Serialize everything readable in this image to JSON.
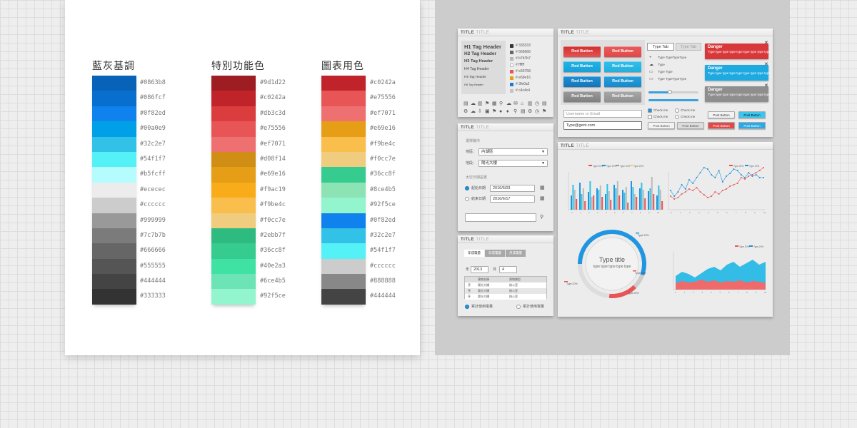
{
  "palette": {
    "gray_blue": {
      "title": "藍灰基調",
      "colors": [
        "#0863b8",
        "#086fcf",
        "#0f82ed",
        "#00a0e9",
        "#32c2e7",
        "#54f1f7",
        "#b5fcff",
        "#ececec",
        "#cccccc",
        "#999999",
        "#7c7b7b",
        "#666666",
        "#555555",
        "#444444",
        "#333333"
      ]
    },
    "function": {
      "title": "特別功能色",
      "colors": [
        "#9d1d22",
        "#c0242a",
        "#db3c3d",
        "#e75556",
        "#ef7071",
        "#d08f14",
        "#e69e16",
        "#f9ac19",
        "#f9be4c",
        "#f0cc7e",
        "#2ebb7f",
        "#36cc8f",
        "#40e2a3",
        "#6ce4b5",
        "#92f5ce"
      ]
    },
    "chart": {
      "title": "圖表用色",
      "colors": [
        "#c0242a",
        "#e75556",
        "#ef7071",
        "#e69e16",
        "#f9be4c",
        "#f0cc7e",
        "#36cc8f",
        "#8ce4b5",
        "#92f5ce",
        "#0f82ed",
        "#32c2e7",
        "#54f1f7",
        "#cccccc",
        "#888888",
        "#444444"
      ]
    }
  },
  "kit": {
    "title_a": "TITLE",
    "title_b": "TITLE",
    "typography": {
      "headers": [
        "H1 Tag Header",
        "H2 Tag Header",
        "H3 Tag Header",
        "H4 Tag Header",
        "H5 Tag Header",
        "H6 Tag Header"
      ],
      "swatches": [
        {
          "label": "# 333333",
          "color": "#333333"
        },
        {
          "label": "# 666666",
          "color": "#666666"
        },
        {
          "label": "# b7b7b7",
          "color": "#b7b7b7"
        },
        {
          "label": "# ffffff",
          "color": "#ffffff"
        },
        {
          "label": "# e55758",
          "color": "#e55758"
        },
        {
          "label": "# e69e16",
          "color": "#e69e16"
        },
        {
          "label": "# 3fe0a2",
          "color": "#1a7fd4"
        },
        {
          "label": "# c4c4c4",
          "color": "#c4c4c4"
        }
      ]
    },
    "buttons": {
      "red_label": "Red Button"
    },
    "tabs": {
      "active": "Type Tab",
      "inactive": "Type Tab"
    },
    "list": [
      "Type TypeTypeType",
      "Type",
      "Type Type",
      "Type TypeTypeType"
    ],
    "alerts": [
      {
        "title": "Danger",
        "text": "Type type type type type type type type type",
        "color": "#d9383a"
      },
      {
        "title": "Danger",
        "text": "Type type type type type type type type type",
        "color": "#1ea9e1"
      },
      {
        "title": "Danger",
        "text": "Type type type type type type type type type",
        "color": "#8e8e8e"
      }
    ],
    "alert_close": "✕",
    "inputs": {
      "username_placeholder": "Username or Email",
      "email_value": "Type@gent.com"
    },
    "checks": [
      "Check.me",
      "Check.me",
      "Check.me",
      "Check.me"
    ],
    "post_button": "Post Button",
    "form": {
      "section1": "選擇縣市",
      "field1_label": "地區：",
      "field1_value": "內湖區",
      "field2_label": "地段：",
      "field2_value": "陽光大樓",
      "section2": "太空日期設置",
      "radio1_label": "起始日期",
      "radio1_value": "2016/6/03",
      "radio2_label": "結束日期",
      "radio2_value": "2016/6/17"
    },
    "table": {
      "tabs": [
        "年成電量",
        "日成電量",
        "月成電量"
      ],
      "year_label": "年",
      "year_value": "2013",
      "month_label": "月",
      "month_value": "4",
      "headers": [
        "",
        "建物名稱",
        "建物類型"
      ],
      "rows": [
        [
          "序",
          "陽光大樓",
          "辦公室"
        ],
        [
          "序",
          "陽光大樓",
          "辦公室"
        ],
        [
          "序",
          "陽光大樓",
          "辦公室"
        ]
      ],
      "radio1": "累計使用電量",
      "radio2": "累計使用電量"
    },
    "charts": {
      "legend": [
        "Type 20%",
        "Type 20%",
        "Type 20%",
        "Type 20%"
      ],
      "donut_title": "Type title",
      "donut_sub": "type type type type type",
      "donut_labels": [
        "Type 20%",
        "Type 20%",
        "Type 20%",
        "Type 20%"
      ],
      "x_ticks": [
        "0",
        "1",
        "2",
        "3",
        "4",
        "5",
        "6",
        "7",
        "8",
        "9",
        "10"
      ]
    }
  }
}
